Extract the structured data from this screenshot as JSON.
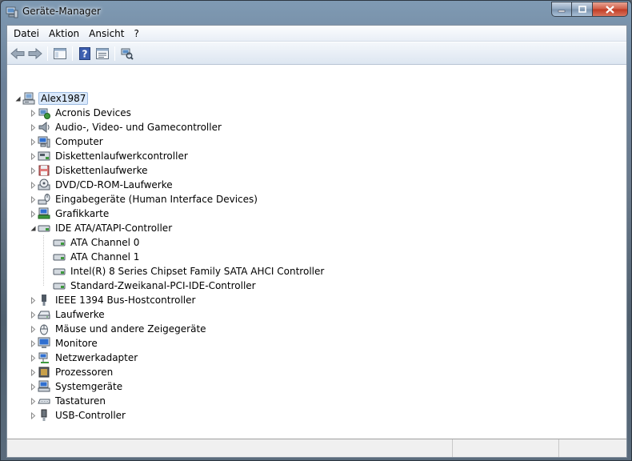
{
  "window": {
    "title": "Geräte-Manager",
    "app_icon": "device-manager-icon",
    "controls": [
      "minimize-icon",
      "maximize-icon",
      "close-icon"
    ]
  },
  "menu": [
    "Datei",
    "Aktion",
    "Ansicht",
    "?"
  ],
  "toolbar": {
    "buttons": [
      "back-arrow-icon",
      "forward-arrow-icon",
      "show-hide-console-tree-icon",
      "help-icon",
      "properties-icon",
      "scan-hardware-icon"
    ]
  },
  "tree": {
    "root": "Alex1987",
    "categories": [
      {
        "label": "Acronis Devices",
        "icon": "acronis-device-icon"
      },
      {
        "label": "Audio-, Video- und Gamecontroller",
        "icon": "speaker-icon"
      },
      {
        "label": "Computer",
        "icon": "computer-icon"
      },
      {
        "label": "Diskettenlaufwerkcontroller",
        "icon": "floppy-controller-icon"
      },
      {
        "label": "Diskettenlaufwerke",
        "icon": "floppy-drive-icon"
      },
      {
        "label": "DVD/CD-ROM-Laufwerke",
        "icon": "dvd-drive-icon"
      },
      {
        "label": "Eingabegeräte (Human Interface Devices)",
        "icon": "hid-icon"
      },
      {
        "label": "Grafikkarte",
        "icon": "display-adapter-icon"
      },
      {
        "label": "IDE ATA/ATAPI-Controller",
        "icon": "ide-controller-icon",
        "expanded": true,
        "children": [
          "ATA Channel 0",
          "ATA Channel 1",
          "Intel(R) 8 Series Chipset Family SATA AHCI Controller",
          "Standard-Zweikanal-PCI-IDE-Controller"
        ]
      },
      {
        "label": "IEEE 1394 Bus-Hostcontroller",
        "icon": "firewire-icon"
      },
      {
        "label": "Laufwerke",
        "icon": "disk-drive-icon"
      },
      {
        "label": "Mäuse und andere Zeigegeräte",
        "icon": "mouse-icon"
      },
      {
        "label": "Monitore",
        "icon": "monitor-icon"
      },
      {
        "label": "Netzwerkadapter",
        "icon": "network-adapter-icon"
      },
      {
        "label": "Prozessoren",
        "icon": "processor-icon"
      },
      {
        "label": "Systemgeräte",
        "icon": "system-device-icon"
      },
      {
        "label": "Tastaturen",
        "icon": "keyboard-icon"
      },
      {
        "label": "USB-Controller",
        "icon": "usb-icon"
      }
    ]
  },
  "colors": {
    "selection_bg": "#d9e8fb",
    "selection_border": "#9dbbe0",
    "close_button": "#c03b23"
  }
}
